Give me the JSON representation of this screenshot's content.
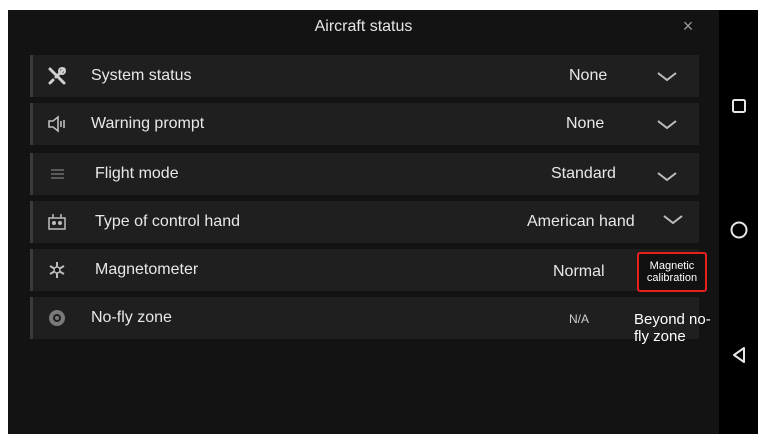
{
  "dialog": {
    "title": "Aircraft status",
    "close_glyph": "×"
  },
  "rows": [
    {
      "icon": "tools-icon",
      "label": "System status",
      "value": "None",
      "has_dropdown": true
    },
    {
      "icon": "speaker-icon",
      "label": "Warning prompt",
      "value": "None",
      "has_dropdown": true
    },
    {
      "icon": "list-icon",
      "label": "Flight mode",
      "value": "Standard",
      "has_dropdown": true
    },
    {
      "icon": "remote-controller-icon",
      "label": "Type of control hand",
      "value": "American hand",
      "has_dropdown": true
    },
    {
      "icon": "magnetometer-icon",
      "label": "Magnetometer",
      "value": "Normal",
      "has_dropdown": false
    },
    {
      "icon": "no-fly-zone-icon",
      "label": "No-fly zone",
      "value": "N/A",
      "has_dropdown": false
    }
  ],
  "magnetic_calibration": {
    "label_line1": "Magnetic",
    "label_line2": "calibration",
    "highlight_color": "#e8201c"
  },
  "no_fly_note": {
    "line1": "Beyond no-",
    "line2": "fly zone"
  },
  "system_nav": {
    "items": [
      "square-icon",
      "circle-icon",
      "triangle-back-icon"
    ]
  }
}
